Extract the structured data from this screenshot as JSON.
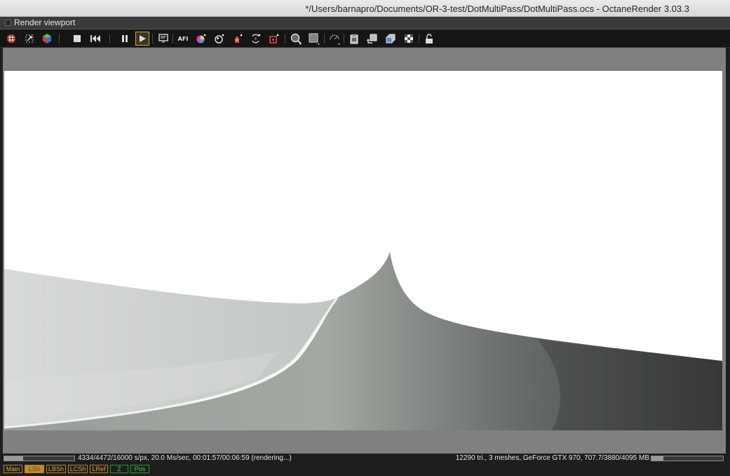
{
  "window": {
    "title": "*/Users/barnapro/Documents/OR-3-test/DotMultiPass/DotMultiPass.ocs - OctaneRender 3.03.3"
  },
  "panel": {
    "title": "Render viewport"
  },
  "toolbar": {
    "afi_label": "AFI",
    "buttons": [
      "recenter-view-icon",
      "reset-view-icon",
      "cube-icon",
      "stop-icon",
      "restart-icon",
      "pause-icon",
      "play-icon",
      "monitor-icon",
      "afi-icon",
      "color-picker-icon",
      "material-picker-icon",
      "object-picker-icon",
      "focus-picker-icon",
      "camera-target-icon",
      "zoom-icon",
      "region-icon",
      "film-region-icon",
      "copy-clipboard-icon",
      "save-render-icon",
      "export-passes-icon",
      "background-icon",
      "lock-icon"
    ],
    "active_button": "play-icon"
  },
  "status": {
    "left_text": "4334/4472/16000 s/px, 20.0 Ms/sec, 00:01:57/00:06:59 (rendering...)",
    "right_text": "12290 tri., 3 meshes, GeForce GTX 970, 707.7/3880/4095 MB",
    "render_progress": 0.27,
    "memory_usage": 0.17
  },
  "passes": [
    {
      "label": "Main",
      "state": "normal"
    },
    {
      "label": "LSh",
      "state": "selected"
    },
    {
      "label": "LBSh",
      "state": "normal"
    },
    {
      "label": "LCSh",
      "state": "normal"
    },
    {
      "label": "LRef",
      "state": "normal"
    },
    {
      "label": "Z",
      "state": "green"
    },
    {
      "label": "Pos",
      "state": "green"
    }
  ],
  "colors": {
    "accent": "#d7a62a",
    "pass_orange": "#e7a73a",
    "pass_green": "#3fd83f",
    "viewport_bg": "#808080"
  }
}
